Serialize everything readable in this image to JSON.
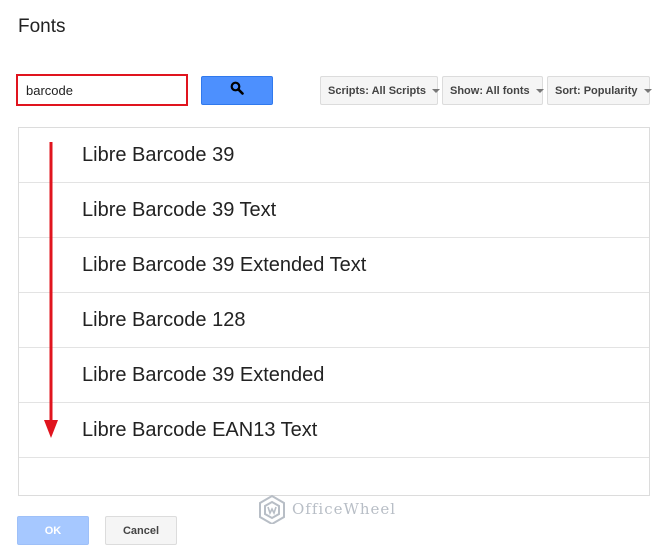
{
  "dialog": {
    "title": "Fonts"
  },
  "search": {
    "value": "barcode",
    "icon": "search-icon",
    "highlight_color": "#e0141e",
    "button_color": "#4d90fe"
  },
  "filters": {
    "scripts_label": "Scripts: All Scripts",
    "show_label": "Show: All fonts",
    "sort_label": "Sort: Popularity"
  },
  "fonts": [
    {
      "name": "Libre Barcode 39"
    },
    {
      "name": "Libre Barcode 39 Text"
    },
    {
      "name": "Libre Barcode 39 Extended Text"
    },
    {
      "name": "Libre Barcode 128"
    },
    {
      "name": "Libre Barcode 39 Extended"
    },
    {
      "name": "Libre Barcode EAN13 Text"
    }
  ],
  "annotation": {
    "arrow_color": "#e0141e"
  },
  "watermark": {
    "text": "OfficeWheel"
  },
  "buttons": {
    "ok_label": "OK",
    "cancel_label": "Cancel"
  }
}
